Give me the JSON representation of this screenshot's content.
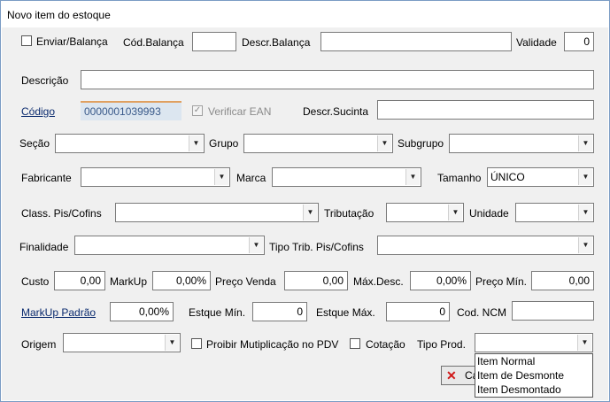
{
  "window": {
    "title": "Novo item do estoque"
  },
  "row1": {
    "enviar_balanca": "Enviar/Balança",
    "cod_balanca_label": "Cód.Balança",
    "cod_balanca_value": "",
    "descr_balanca_label": "Descr.Balança",
    "descr_balanca_value": "",
    "validade_label": "Validade",
    "validade_value": "0"
  },
  "row2": {
    "descricao_label": "Descrição",
    "descricao_value": ""
  },
  "row3": {
    "codigo_label": "Código",
    "codigo_value": "0000001039993",
    "verificar_ean": "Verificar EAN",
    "descr_sucinta_label": "Descr.Sucinta",
    "descr_sucinta_value": ""
  },
  "row4": {
    "secao": "Seção",
    "grupo": "Grupo",
    "subgrupo": "Subgrupo"
  },
  "row5": {
    "fabricante": "Fabricante",
    "marca": "Marca",
    "tamanho": "Tamanho",
    "tamanho_value": "ÚNICO"
  },
  "row6": {
    "class_pis": "Class. Pis/Cofins",
    "tributacao": "Tributação",
    "unidade": "Unidade"
  },
  "row7": {
    "finalidade": "Finalidade",
    "tipo_trib": "Tipo Trib. Pis/Cofins"
  },
  "row8": {
    "custo_label": "Custo",
    "custo_value": "0,00",
    "markup_label": "MarkUp",
    "markup_value": "0,00%",
    "preco_venda_label": "Preço Venda",
    "preco_venda_value": "0,00",
    "max_desc_label": "Máx.Desc.",
    "max_desc_value": "0,00%",
    "preco_min_label": "Preço Mín.",
    "preco_min_value": "0,00"
  },
  "row9": {
    "markup_padrao_label": "MarkUp Padrão",
    "markup_padrao_value": "0,00%",
    "estque_min_label": "Estque Mín.",
    "estque_min_value": "0",
    "estque_max_label": "Estque Máx.",
    "estque_max_value": "0",
    "cod_ncm_label": "Cod. NCM",
    "cod_ncm_value": ""
  },
  "row10": {
    "origem": "Origem",
    "proibir": "Proibir Mutiplicação no PDV",
    "cotacao": "Cotação",
    "tipo_prod": "Tipo Prod."
  },
  "tipo_prod_options": [
    "Item Normal",
    "Item de Desmonte",
    "Item Desmontado"
  ],
  "cancel_button": {
    "label": "Ca"
  },
  "colors": {
    "window_border": "#7a9cc4",
    "panel_bg": "#f0f0f0",
    "codigo_bg": "#dce6f0",
    "cancel_icon": "#d01818"
  },
  "icons": [
    "chevron-down-icon",
    "cancel-x-icon",
    "checkmark-icon"
  ]
}
